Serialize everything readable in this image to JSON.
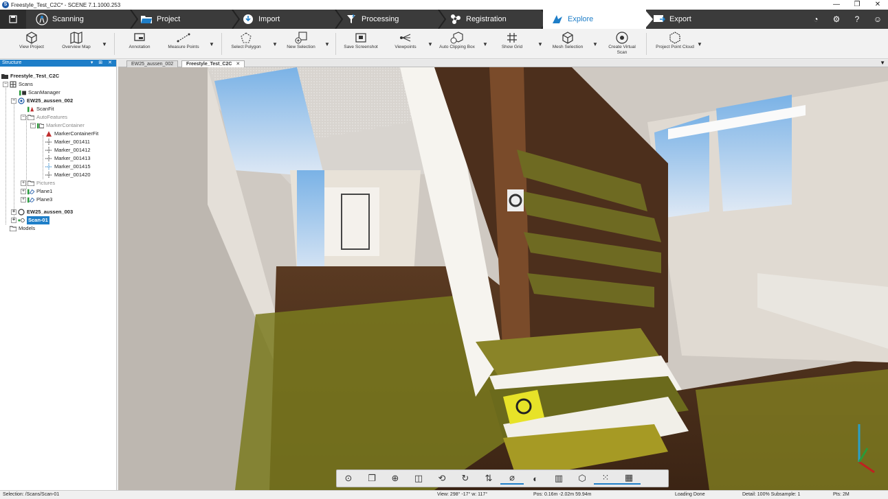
{
  "window": {
    "title": "Freestyle_Test_C2C* - SCENE 7.1.1000.253",
    "controls": [
      "—",
      "❐",
      "✕"
    ]
  },
  "workflow": {
    "tabs": [
      {
        "label": "Scanning"
      },
      {
        "label": "Project"
      },
      {
        "label": "Import"
      },
      {
        "label": "Processing"
      },
      {
        "label": "Registration"
      },
      {
        "label": "Explore",
        "active": true
      },
      {
        "label": "Export"
      }
    ],
    "accent": "#1e7ec8"
  },
  "ribbon": {
    "items": [
      "View Project",
      "Overview Map",
      "Annotation",
      "Measure Points",
      "Select Polygon",
      "New Selection",
      "Save Screenshot",
      "Viewpoints",
      "Auto Clipping Box",
      "Show Grid",
      "Mesh Selection",
      "Create Virtual Scan",
      "Project Point Cloud"
    ]
  },
  "structure": {
    "title": "Structure",
    "tree": {
      "root": "Freestyle_Test_C2C",
      "scans": "Scans",
      "scan_manager": "ScanManager",
      "scan1": "EW25_aussen_002",
      "scanfit": "ScanFit",
      "autofeatures": "AutoFeatures",
      "markercontainer": "MarkerContainer",
      "markercontainerfit": "MarkerContainerFit",
      "markers": [
        "Marker_001411",
        "Marker_001412",
        "Marker_001413",
        "Marker_001415",
        "Marker_001420"
      ],
      "pictures": "Pictures",
      "plane1": "Plane1",
      "plane3": "Plane3",
      "scan2": "EW25_aussen_003",
      "scan3": "Scan-01",
      "models": "Models"
    }
  },
  "doc_tabs": [
    {
      "label": "EW25_aussen_002"
    },
    {
      "label": "Freestyle_Test_C2C",
      "active": true
    }
  ],
  "statusbar": {
    "selection": "Selection: /Scans/Scan-01",
    "view": "View: 298° -17° w: 117°",
    "pos": "Pos: 0.16m -2.02m 59.94m",
    "loading": "Loading Done",
    "detail": "Detail: 100%  Subsample: 1",
    "pts": "Pts: 2M"
  }
}
